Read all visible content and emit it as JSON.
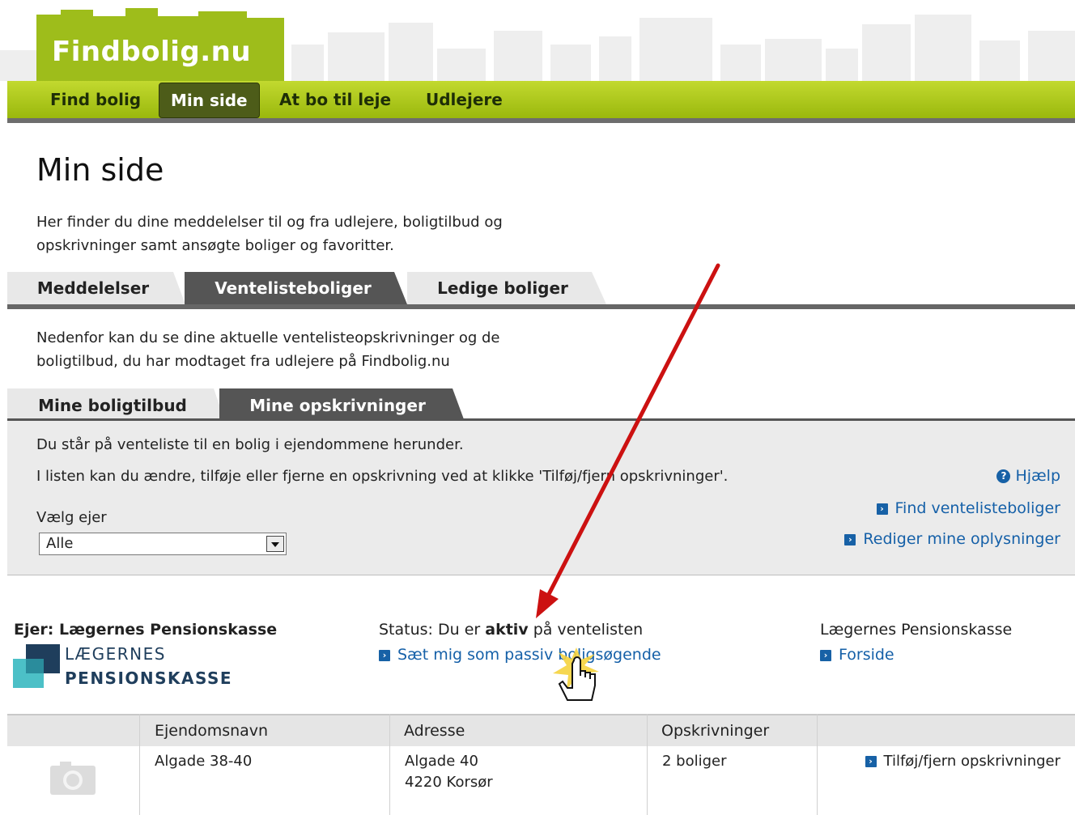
{
  "site": {
    "logo_text": "Findbolig.nu"
  },
  "nav": {
    "items": [
      {
        "label": "Find bolig"
      },
      {
        "label": "Min side"
      },
      {
        "label": "At bo til leje"
      },
      {
        "label": "Udlejere"
      }
    ],
    "active": "Min side"
  },
  "page": {
    "title": "Min side",
    "intro_line1": "Her finder du dine meddelelser til og fra udlejere, boligtilbud og",
    "intro_line2": "opskrivninger samt ansøgte boliger og favoritter."
  },
  "main_tabs": [
    {
      "label": "Meddelelser"
    },
    {
      "label": "Ventelisteboliger"
    },
    {
      "label": "Ledige boliger"
    }
  ],
  "ventelist": {
    "text_line1": "Nedenfor kan du se dine aktuelle ventelisteopskrivninger og de",
    "text_line2": "boligtilbud, du har modtaget fra udlejere på Findbolig.nu"
  },
  "sub_tabs": [
    {
      "label": "Mine boligtilbud"
    },
    {
      "label": "Mine opskrivninger"
    }
  ],
  "panel": {
    "line1": "Du står på venteliste til en bolig i ejendommene herunder.",
    "line2": "I listen kan du ændre, tilføje eller fjerne en opskrivning ved at klikke 'Tilføj/fjern opskrivninger'.",
    "help": "Hjælp",
    "find_link": "Find ventelisteboliger",
    "edit_link": "Rediger mine oplysninger",
    "owner_label": "Vælg ejer",
    "owner_value": "Alle"
  },
  "owner": {
    "title": "Ejer: Lægernes Pensionskasse",
    "logo_line1": "LÆGERNES",
    "logo_line2": "PENSIONSKASSE",
    "status_prefix": "Status: Du er ",
    "status_bold": "aktiv",
    "status_suffix": " på ventelisten",
    "passive_link": "Sæt mig som passiv boligsøgende",
    "right_title": "Lægernes Pensionskasse",
    "right_link": "Forside"
  },
  "table": {
    "headers": [
      "Ejendomsnavn",
      "Adresse",
      "Opskrivninger"
    ],
    "rows": [
      {
        "name": "Algade 38-40",
        "address_line1": "Algade 40",
        "address_line2": "4220 Korsør",
        "count": "2 boliger",
        "action": "Tilføj/fjern opskrivninger"
      }
    ]
  },
  "colors": {
    "nav_green": "#a9c41c",
    "active_tab": "#555555",
    "link": "#1560a8",
    "annotation_arrow": "#cc1111"
  }
}
